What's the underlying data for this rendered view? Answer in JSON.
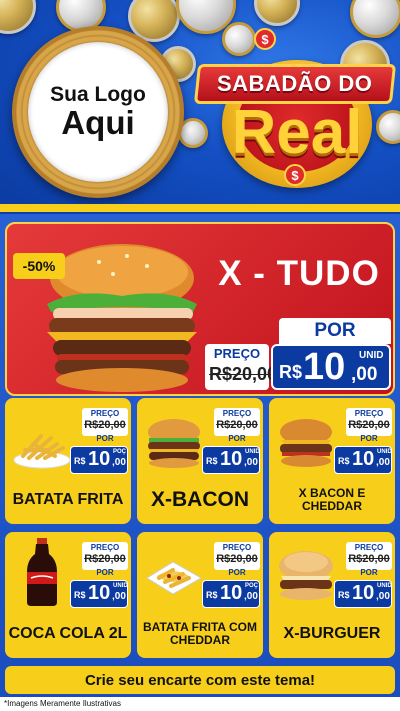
{
  "header": {
    "logo_line1": "Sua Logo",
    "logo_line2": "Aqui",
    "title_top": "SABADÃO DO",
    "title_main": "Real",
    "currency_symbol": "$"
  },
  "featured": {
    "discount": "-50%",
    "name": "X - TUDO",
    "preco_label": "PREÇO",
    "old_price": "R$20,00",
    "por_label": "POR",
    "currency": "R$",
    "price_int": "10",
    "price_dec": ",00",
    "unit": "UNID"
  },
  "products": [
    {
      "name": "BATATA FRITA",
      "preco_label": "PREÇO",
      "old_price": "R$20,00",
      "por_label": "POR",
      "currency": "R$",
      "price_int": "10",
      "price_dec": ",00",
      "unit": "POÇ",
      "icon": "fries-icon"
    },
    {
      "name": "X-BACON",
      "preco_label": "PREÇO",
      "old_price": "R$20,00",
      "por_label": "POR",
      "currency": "R$",
      "price_int": "10",
      "price_dec": ",00",
      "unit": "UNID",
      "icon": "burger-icon"
    },
    {
      "name": "X BACON E CHEDDAR",
      "preco_label": "PREÇO",
      "old_price": "R$20,00",
      "por_label": "POR",
      "currency": "R$",
      "price_int": "10",
      "price_dec": ",00",
      "unit": "UNID",
      "icon": "burger-icon"
    },
    {
      "name": "COCA COLA 2L",
      "preco_label": "PREÇO",
      "old_price": "R$20,00",
      "por_label": "POR",
      "currency": "R$",
      "price_int": "10",
      "price_dec": ",00",
      "unit": "UNID",
      "icon": "bottle-icon"
    },
    {
      "name": "BATATA FRITA COM CHEDDAR",
      "preco_label": "PREÇO",
      "old_price": "R$20,00",
      "por_label": "POR",
      "currency": "R$",
      "price_int": "10",
      "price_dec": ",00",
      "unit": "POÇ",
      "icon": "fries-cheddar-icon"
    },
    {
      "name": "X-BURGUER",
      "preco_label": "PREÇO",
      "old_price": "R$20,00",
      "por_label": "POR",
      "currency": "R$",
      "price_int": "10",
      "price_dec": ",00",
      "unit": "UNID",
      "icon": "burger-icon"
    }
  ],
  "cta": "Crie seu encarte com este tema!",
  "disclaimer": "*Imagens Meramente Ilustrativas",
  "colors": {
    "blue": "#1a4cbc",
    "dark_blue": "#0b3aa0",
    "yellow": "#f7cf1b",
    "red": "#c1121d"
  }
}
